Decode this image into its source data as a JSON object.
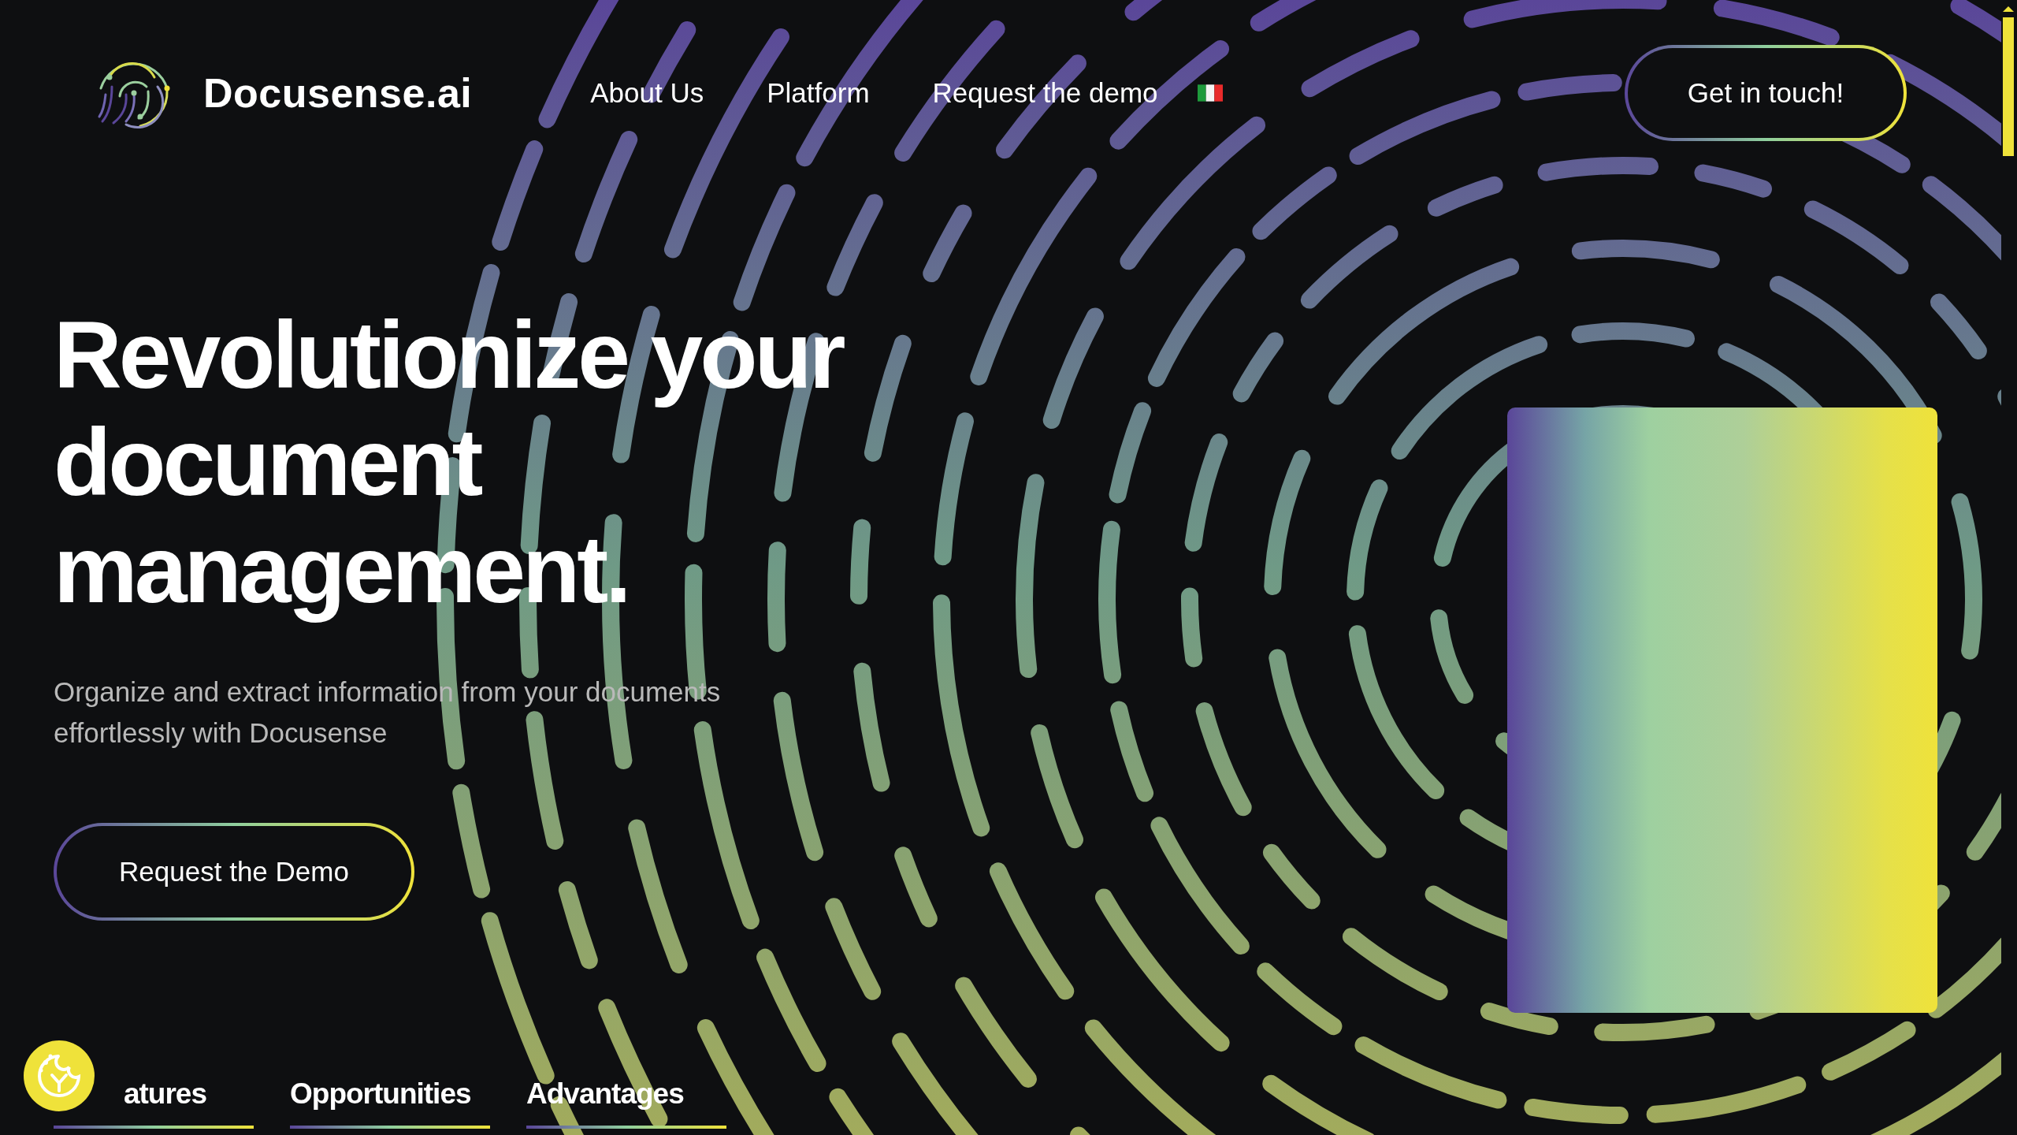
{
  "brand": {
    "name": "Docusense.ai"
  },
  "nav": {
    "links": [
      {
        "label": "About Us"
      },
      {
        "label": "Platform"
      },
      {
        "label": "Request the demo"
      }
    ],
    "contact_button": "Get in touch!"
  },
  "hero": {
    "title": "Revolutionize your document management.",
    "subtitle": "Organize and extract information from your documents effortlessly with Docusense",
    "button": "Request the Demo"
  },
  "tabs": [
    {
      "label": "atures"
    },
    {
      "label": "Opportunities"
    },
    {
      "label": "Advantages"
    }
  ]
}
